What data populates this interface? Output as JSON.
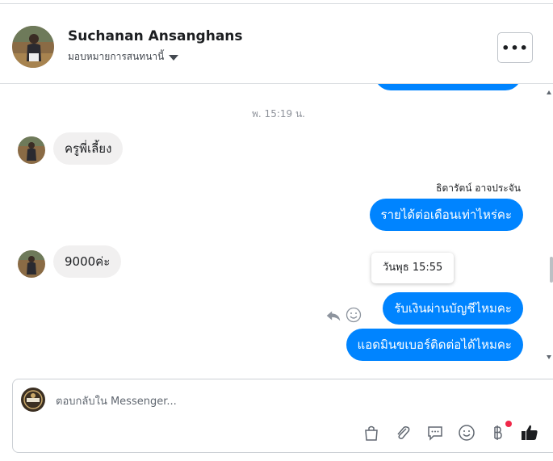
{
  "header": {
    "contact_name": "Suchanan Ansanghans",
    "assign_label": "มอบหมายการสนทนานี้",
    "more_label": "•••"
  },
  "conversation": {
    "timestamp": "พ. 15:19 น.",
    "messages": [
      {
        "direction": "in",
        "text": "ครูพี่เลี้ยง"
      },
      {
        "direction": "out",
        "sender": "ธิดารัตน์ อาจประจัน",
        "text": "รายได้ต่อเดือนเท่าไหร่คะ"
      },
      {
        "direction": "in",
        "text": "9000ค่ะ"
      },
      {
        "direction": "out",
        "text": "รับเงินผ่านบัญชีไหมคะ"
      },
      {
        "direction": "out",
        "text": "แอดมินขเบอร์ติดต่อได้ไหมคะ"
      }
    ],
    "tooltip": "วันพุธ 15:55"
  },
  "composer": {
    "placeholder": "ตอบกลับใน Messenger..."
  },
  "toolbar_icons": [
    "shopping-bag-icon",
    "paperclip-icon",
    "message-bubble-icon",
    "emoji-icon",
    "baht-icon",
    "thumbs-up-icon"
  ],
  "colors": {
    "outgoing_bubble": "#0084ff",
    "incoming_bubble": "#f1f0f0",
    "notification_dot": "#f02849"
  }
}
